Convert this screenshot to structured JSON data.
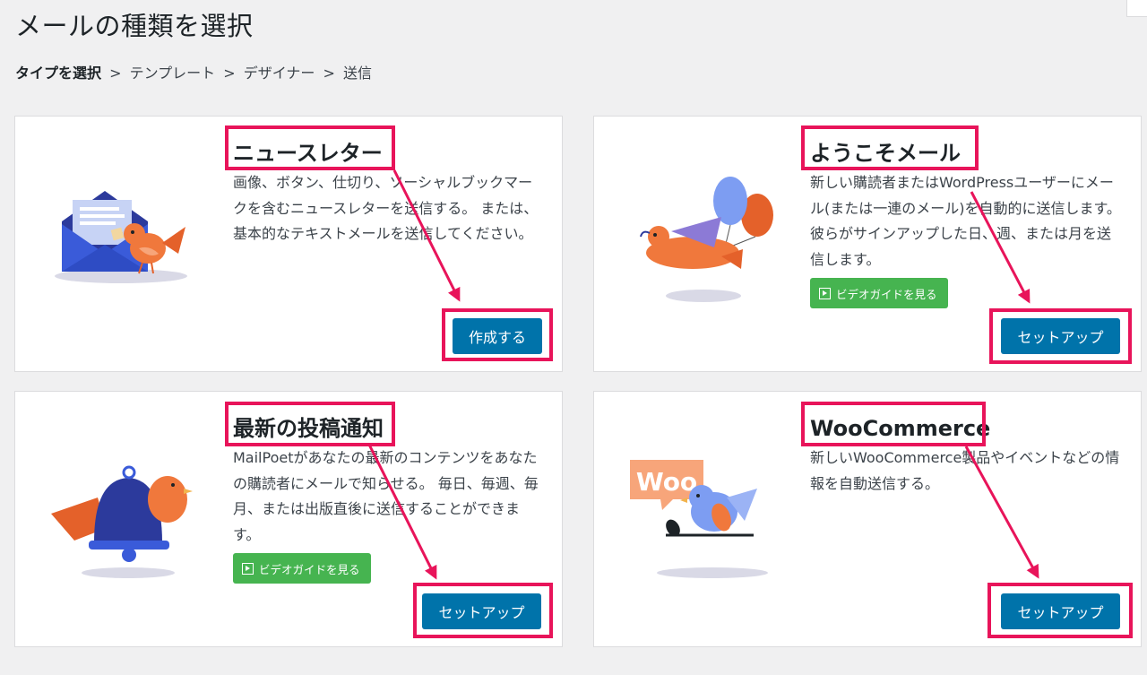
{
  "page": {
    "title": "メールの種類を選択",
    "breadcrumb": {
      "active": "タイプを選択",
      "steps": [
        "テンプレート",
        "デザイナー",
        "送信"
      ],
      "separator": ">"
    }
  },
  "cards": {
    "newsletter": {
      "title": "ニュースレター",
      "description": "画像、ボタン、仕切り、ソーシャルブックマークを含むニュースレターを送信する。 または、基本的なテキストメールを送信してください。",
      "button": "作成する"
    },
    "welcome": {
      "title": "ようこそメール",
      "description": "新しい購読者またはWordPressユーザーにメール(または一連のメール)を自動的に送信します。 彼らがサインアップした日、週、または月を送信します。",
      "video": "ビデオガイドを見る",
      "button": "セットアップ"
    },
    "post_notification": {
      "title": "最新の投稿通知",
      "description": "MailPoetがあなたの最新のコンテンツをあなたの購読者にメールで知らせる。 毎日、毎週、毎月、または出版直後に送信することができます。",
      "video": "ビデオガイドを見る",
      "button": "セットアップ"
    },
    "woocommerce": {
      "title": "WooCommerce",
      "description": "新しいWooCommerce製品やイベントなどの情報を自動送信する。",
      "button": "セットアップ",
      "badge": "Woo"
    }
  },
  "colors": {
    "primary_button": "#0073aa",
    "video_button": "#46b450",
    "annotation": "#e8145a",
    "envelope": "#3a5bd9",
    "bird": "#f0783c"
  },
  "icons": {
    "newsletter": "envelope-bird-illustration",
    "welcome": "bird-balloons-illustration",
    "post_notification": "bell-bird-illustration",
    "woocommerce": "woo-bird-illustration",
    "video": "play-icon"
  }
}
